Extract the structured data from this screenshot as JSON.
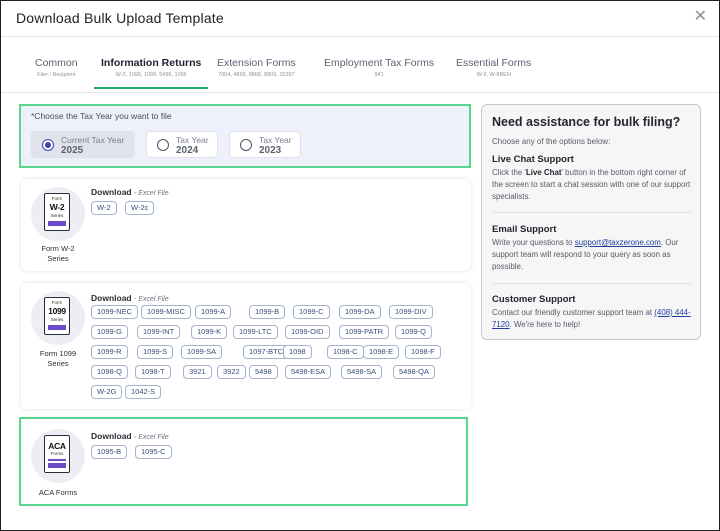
{
  "modal": {
    "title": "Download Bulk Upload Template"
  },
  "tabs": [
    {
      "label": "Common",
      "sub": "Filer / Recipient"
    },
    {
      "label": "Information Returns",
      "sub": "W-2, 1099, 1098, 5498, 1095"
    },
    {
      "label": "Extension Forms",
      "sub": "7004, 4868, 8868, 8809, 15397"
    },
    {
      "label": "Employment Tax Forms",
      "sub": "941"
    },
    {
      "label": "Essential Forms",
      "sub": "W-9, W-8BEN"
    }
  ],
  "tax_year": {
    "label": "*Choose the Tax Year you want to file",
    "options": [
      {
        "title": "Current Tax Year",
        "year": "2025",
        "selected": true
      },
      {
        "title": "Tax Year",
        "year": "2024",
        "selected": false
      },
      {
        "title": "Tax Year",
        "year": "2023",
        "selected": false
      }
    ]
  },
  "download": {
    "label": "Download",
    "suffix": "- Excel File"
  },
  "forms": {
    "w2": {
      "icon": {
        "line1": "Form",
        "line2": "W-2",
        "line3": "Series"
      },
      "name_line1": "Form W-2",
      "name_line2": "Series",
      "chips": [
        "W-2",
        "W-2c"
      ]
    },
    "f1099": {
      "icon": {
        "line1": "Form",
        "line2": "1099",
        "line3": "Series"
      },
      "name_line1": "Form 1099",
      "name_line2": "Series",
      "chips": [
        "1099-NEC",
        "1099-MISC",
        "1099-A",
        "1099-B",
        "1099-C",
        "1099-DA",
        "1099-DIV",
        "1099-G",
        "1099-INT",
        "1099-K",
        "1099-LTC",
        "1099-OID",
        "1099-PATR",
        "1099-Q",
        "1099-R",
        "1099-S",
        "1099-SA",
        "1097-BTC",
        "1098",
        "1098-C",
        "1098-E",
        "1098-F",
        "1098-Q",
        "1098-T",
        "3921",
        "3922",
        "5498",
        "5498-ESA",
        "5498-SA",
        "5498-QA",
        "W-2G",
        "1042-S"
      ]
    },
    "aca": {
      "icon": {
        "line1": "",
        "line2": "ACA",
        "line3": "Forms"
      },
      "name_line1": "ACA Forms",
      "chips": [
        "1095-B",
        "1095-C"
      ]
    }
  },
  "assistance": {
    "title": "Need assistance for bulk filing?",
    "subtitle": "Choose any of the options below:",
    "live_chat": {
      "heading": "Live Chat Support",
      "text_before": "Click the '",
      "button_name": "Live Chat",
      "text_after": "' button in the bottom right corner of the screen to start a chat session with one of our support specialists."
    },
    "email": {
      "heading": "Email Support",
      "text_before": "Write your questions to",
      "address": "support@taxzerone.com",
      "text_after": ". Our support team will respond to your query as soon as possible."
    },
    "customer": {
      "heading": "Customer Support",
      "text_before": "Contact our friendly customer support team at",
      "phone": "(408) 444-7120",
      "text_after": ". We're here to help!"
    }
  },
  "colors": {
    "accent_green": "#22a76a",
    "highlight_green": "#58d68d",
    "radio_blue": "#3b44a8",
    "link_blue": "#1e3f9c",
    "doc_bar": "#6b4cc7"
  }
}
